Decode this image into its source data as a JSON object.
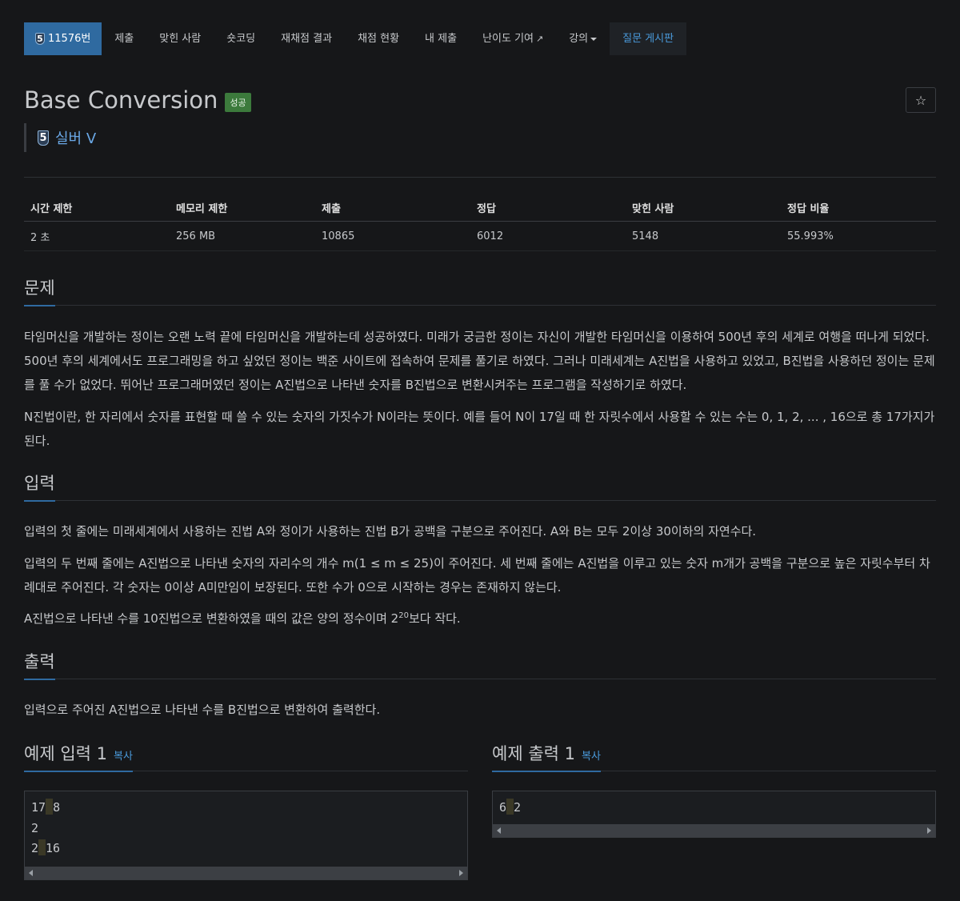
{
  "nav": {
    "problem_id": "11576번",
    "tier_badge": "5",
    "items": [
      {
        "label": "제출"
      },
      {
        "label": "맞힌 사람"
      },
      {
        "label": "숏코딩"
      },
      {
        "label": "재채점 결과"
      },
      {
        "label": "채점 현황"
      },
      {
        "label": "내 제출"
      },
      {
        "label": "난이도 기여"
      },
      {
        "label": "강의"
      }
    ],
    "board": "질문 게시판"
  },
  "problem": {
    "title": "Base Conversion",
    "status": "성공",
    "tier": "실버 V",
    "star": "☆"
  },
  "info_table": {
    "headers": [
      "시간 제한",
      "메모리 제한",
      "제출",
      "정답",
      "맞힌 사람",
      "정답 비율"
    ],
    "values": [
      "2 초",
      "256 MB",
      "10865",
      "6012",
      "5148",
      "55.993%"
    ]
  },
  "sections": {
    "problem_heading": "문제",
    "problem_p1": "타임머신을 개발하는 정이는 오랜 노력 끝에 타임머신을 개발하는데 성공하였다. 미래가 궁금한 정이는 자신이 개발한 타임머신을 이용하여 500년 후의 세계로 여행을 떠나게 되었다. 500년 후의 세계에서도 프로그래밍을 하고 싶었던 정이는 백준 사이트에 접속하여 문제를 풀기로 하였다. 그러나 미래세계는 A진법을 사용하고 있었고, B진법을 사용하던 정이는 문제를 풀 수가 없었다. 뛰어난 프로그래머였던 정이는 A진법으로 나타낸 숫자를 B진법으로 변환시켜주는 프로그램을 작성하기로 하였다.",
    "problem_p2": "N진법이란, 한 자리에서 숫자를 표현할 때 쓸 수 있는 숫자의 가짓수가 N이라는 뜻이다. 예를 들어 N이 17일 때 한 자릿수에서 사용할 수 있는 수는 0, 1, 2, ... , 16으로 총 17가지가 된다.",
    "input_heading": "입력",
    "input_p1": "입력의 첫 줄에는 미래세계에서 사용하는 진법 A와 정이가 사용하는 진법 B가 공백을 구분으로 주어진다. A와 B는 모두 2이상 30이하의 자연수다.",
    "input_p2": "입력의 두 번째 줄에는 A진법으로 나타낸 숫자의 자리수의 개수 m(1 ≤ m ≤ 25)이 주어진다. 세 번째 줄에는 A진법을 이루고 있는 숫자 m개가 공백을 구분으로 높은 자릿수부터 차례대로 주어진다. 각 숫자는 0이상 A미만임이 보장된다. 또한 수가 0으로 시작하는 경우는 존재하지 않는다.",
    "input_p3_before": "A진법으로 나타낸 수를 10진법으로 변환하였을 때의 값은 양의 정수이며 2",
    "input_p3_sup": "20",
    "input_p3_after": "보다 작다.",
    "output_heading": "출력",
    "output_p1": "입력으로 주어진 A진법으로 나타낸 수를 B진법으로 변환하여 출력한다."
  },
  "samples": {
    "input_title": "예제 입력 1",
    "output_title": "예제 출력 1",
    "copy_label": "복사",
    "input_lines": [
      [
        "17",
        "8"
      ],
      [
        "2"
      ],
      [
        "2",
        "16"
      ]
    ],
    "output_lines": [
      [
        "6",
        "2"
      ]
    ]
  }
}
